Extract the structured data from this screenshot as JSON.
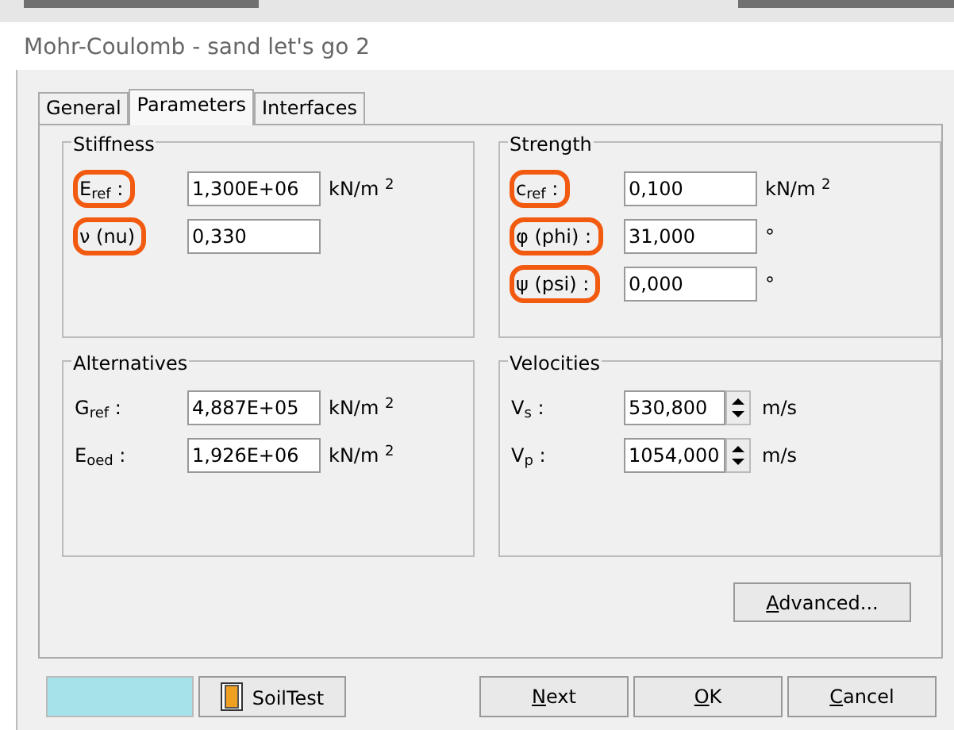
{
  "window": {
    "title": "Mohr-Coulomb - sand let's go 2"
  },
  "tabs": [
    {
      "label": "General",
      "selected": false
    },
    {
      "label": "Parameters",
      "selected": true
    },
    {
      "label": "Interfaces",
      "selected": false
    }
  ],
  "groups": [
    {
      "title": "Stiffness",
      "fields": [
        {
          "label": "E$_{ref}$ :",
          "value": "1,300E+06",
          "unit": "kN/m $^{2}$",
          "kind": "text",
          "circled": true
        },
        {
          "label": "ν (nu)",
          "value": "0,330",
          "kind": "text",
          "circled": true
        }
      ]
    },
    {
      "title": "Strength",
      "fields": [
        {
          "label": "c$_{ref}$ :",
          "value": "0,100",
          "unit": "kN/m $^{2}$",
          "kind": "text",
          "circled": true
        },
        {
          "label": "φ (phi) :",
          "value": "31,000",
          "unit": "°",
          "kind": "text",
          "circled": true
        },
        {
          "label": "ψ (psi) :",
          "value": "0,000",
          "unit": "°",
          "kind": "text",
          "circled": true
        }
      ]
    },
    {
      "title": "Alternatives",
      "fields": [
        {
          "label": "G$_{ref}$ :",
          "value": "4,887E+05",
          "unit": "kN/m $^{2}$",
          "kind": "text",
          "circled": false
        },
        {
          "label": "E$_{oed}$ :",
          "value": "1,926E+06",
          "unit": "kN/m $^{2}$",
          "kind": "text",
          "circled": false
        }
      ]
    },
    {
      "title": "Velocities",
      "fields": [
        {
          "label": "V$_{s}$ :",
          "value": "530,800",
          "unit": "m/s",
          "kind": "spinner",
          "circled": false
        },
        {
          "label": "V$_{p}$ :",
          "value": "1054,000",
          "unit": "m/s",
          "kind": "spinner",
          "circled": false
        }
      ]
    }
  ],
  "advanced_button": {
    "mnemonic": "A",
    "rest": "dvanced..."
  },
  "color_swatch": {
    "color": "#a4e3ea"
  },
  "soiltest_button": {
    "label": "SoilTest"
  },
  "buttons": [
    {
      "mnemonic": "N",
      "rest": "ext"
    },
    {
      "mnemonic": "O",
      "rest": "K"
    },
    {
      "mnemonic": "C",
      "rest": "ancel"
    }
  ]
}
